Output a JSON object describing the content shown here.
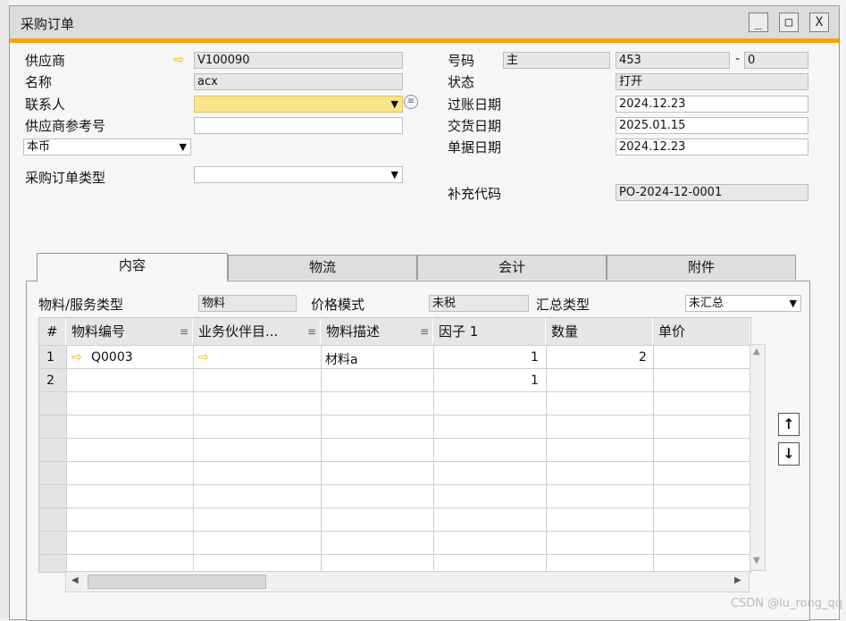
{
  "window": {
    "title": "采购订单",
    "minimize": "_",
    "maximize": "□",
    "close": "X"
  },
  "header": {
    "vendor": {
      "label": "供应商",
      "value": "V100090"
    },
    "name": {
      "label": "名称",
      "value": "acx"
    },
    "contact": {
      "label": "联系人",
      "value": ""
    },
    "vendor_ref": {
      "label": "供应商参考号",
      "value": ""
    },
    "currency": {
      "value": "本币"
    },
    "order_type": {
      "label": "采购订单类型",
      "value": ""
    },
    "number": {
      "label": "号码",
      "series": "主",
      "value": "453",
      "suffix": "0",
      "dash": "-"
    },
    "status": {
      "label": "状态",
      "value": "打开"
    },
    "posting_date": {
      "label": "过账日期",
      "value": "2024.12.23"
    },
    "delivery_date": {
      "label": "交货日期",
      "value": "2025.01.15"
    },
    "document_date": {
      "label": "单据日期",
      "value": "2024.12.23"
    },
    "supplementary_code": {
      "label": "补充代码",
      "value": "PO-2024-12-0001"
    }
  },
  "tabs": [
    "内容",
    "物流",
    "会计",
    "附件"
  ],
  "content": {
    "item_type": {
      "label": "物料/服务类型",
      "value": "物料"
    },
    "price_mode": {
      "label": "价格模式",
      "value": "未税"
    },
    "summary_type": {
      "label": "汇总类型",
      "value": "未汇总"
    }
  },
  "grid": {
    "columns": [
      "#",
      "物料编号",
      "业务伙伴目...",
      "物料描述",
      "因子 1",
      "数量",
      "单价"
    ],
    "rows": [
      {
        "num": "1",
        "item": "Q0003",
        "desc": "材料a",
        "factor": "1",
        "qty": "2"
      },
      {
        "num": "2",
        "item": "",
        "desc": "",
        "factor": "1",
        "qty": ""
      }
    ]
  },
  "watermark": "CSDN @lu_rong_qq"
}
